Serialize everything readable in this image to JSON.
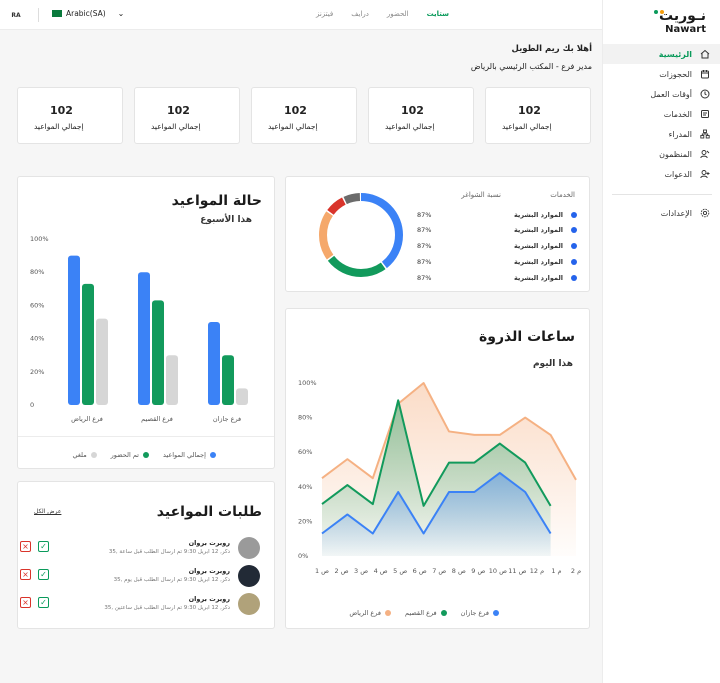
{
  "sidebar": {
    "logo": {
      "arabic": "نـوريت",
      "english": "Nawart"
    },
    "items": [
      {
        "label": "الرئيسية",
        "icon": "home-icon",
        "active": true
      },
      {
        "label": "الحجوزات",
        "icon": "bookings-icon"
      },
      {
        "label": "أوقات العمل",
        "icon": "clock-icon"
      },
      {
        "label": "الخدمات",
        "icon": "services-icon"
      },
      {
        "label": "المدراء",
        "icon": "managers-icon"
      },
      {
        "label": "المنظمون",
        "icon": "organizers-icon"
      },
      {
        "label": "الدعوات",
        "icon": "invitations-icon"
      }
    ],
    "settings": {
      "label": "الإعدادات",
      "icon": "settings-icon"
    }
  },
  "topbar": {
    "avatar": "RA",
    "language": "Arabic(SA)",
    "tabs": [
      {
        "label": "فيتزنز",
        "active": false
      },
      {
        "label": "درايف",
        "active": false
      },
      {
        "label": "الحضور",
        "active": false
      },
      {
        "label": "ستايت",
        "active": true
      }
    ]
  },
  "welcome": {
    "title": "أهلا بك ريم الطويل",
    "subtitle": "مدير فرع - المكتب الرئيسي بالرياض"
  },
  "stats": [
    {
      "value": "102",
      "label": "إجمالي المواعيد"
    },
    {
      "value": "102",
      "label": "إجمالي المواعيد"
    },
    {
      "value": "102",
      "label": "إجمالي المواعيد"
    },
    {
      "value": "102",
      "label": "إجمالي المواعيد"
    },
    {
      "value": "102",
      "label": "إجمالي المواعيد"
    }
  ],
  "services": {
    "header_services": "الخدمات",
    "header_vacancy": "نسبة الشواغر",
    "rows": [
      {
        "name": "الموارد البشرية",
        "pct": "87%"
      },
      {
        "name": "الموارد البشرية",
        "pct": "87%"
      },
      {
        "name": "الموارد البشرية",
        "pct": "87%"
      },
      {
        "name": "الموارد البشرية",
        "pct": "87%"
      },
      {
        "name": "الموارد البشرية",
        "pct": "87%"
      }
    ]
  },
  "appointments": {
    "title": "حالة المواعيد",
    "subtitle": "هذا الأسبوع",
    "legend": [
      "إجمالي المواعيد",
      "تم الحضور",
      "ملغي"
    ]
  },
  "peak": {
    "title": "ساعات الذروة",
    "subtitle": "هذا اليوم",
    "legend": [
      "فرع جازان",
      "فرع القصيم",
      "فرع الرياض"
    ]
  },
  "requests": {
    "title": "طلبات المواعيد",
    "show_all": "عرض الكل",
    "items": [
      {
        "name": "روبرت بروان",
        "detail": "35, دكر, 12 ابريل 9:30 تم ارسال الطلب قبل ساعة",
        "avatar": "#9a9a9a"
      },
      {
        "name": "روبرت بروان",
        "detail": "35, دكر, 12 ابريل 9:30 تم ارسال الطلب قبل يوم",
        "avatar": "#222a36"
      },
      {
        "name": "روبرت بروان",
        "detail": "35, دكر, 12 ابريل 9:30 تم ارسال الطلب قبل ساعتين",
        "avatar": "#b0a27a"
      }
    ]
  },
  "colors": {
    "accent": "#0a9a5b",
    "blue": "#3b82f6",
    "green": "#129a5c",
    "gray": "#d6d6d6",
    "orange": "#f5b183",
    "danger": "#d9342b"
  },
  "chart_data": [
    {
      "type": "donut",
      "values": [
        40,
        25,
        20,
        8,
        7
      ],
      "colors": [
        "#3b82f6",
        "#129a5c",
        "#f5a86b",
        "#d9342b",
        "#6b6b6b"
      ]
    },
    {
      "type": "bar",
      "categories": [
        "فرع الرياض",
        "فرع القصيم",
        "فرع جازان"
      ],
      "series": [
        {
          "name": "إجمالي المواعيد",
          "color": "#3b82f6",
          "values": [
            90,
            80,
            50
          ]
        },
        {
          "name": "تم الحضور",
          "color": "#129a5c",
          "values": [
            73,
            63,
            30
          ]
        },
        {
          "name": "ملغي",
          "color": "#d6d6d6",
          "values": [
            52,
            30,
            10
          ]
        }
      ],
      "yticks": [
        "0",
        "20%",
        "40%",
        "60%",
        "80%",
        "100%"
      ],
      "ylim": [
        0,
        100
      ]
    },
    {
      "type": "area",
      "categories": [
        "2 م",
        "1 م",
        "12 م",
        "11 ص",
        "10 ص",
        "9 ص",
        "8 ص",
        "7 ص",
        "6 ص",
        "5 ص",
        "4 ص",
        "3 ص",
        "2 ص",
        "1 ص"
      ],
      "series": [
        {
          "name": "فرع الرياض",
          "color": "#f5b183",
          "values": [
            45,
            56,
            45,
            88,
            100,
            72,
            70,
            70,
            80,
            70,
            44
          ]
        },
        {
          "name": "فرع القصيم",
          "color": "#129a5c",
          "values": [
            30,
            41,
            30,
            90,
            29,
            54,
            54,
            65,
            54,
            29
          ]
        },
        {
          "name": "فرع جازان",
          "color": "#3b82f6",
          "values": [
            13,
            24,
            13,
            37,
            13,
            37,
            37,
            48,
            37,
            13
          ]
        }
      ],
      "yticks": [
        "0%",
        "20%",
        "40%",
        "60%",
        "80%",
        "100%"
      ],
      "ylim": [
        0,
        100
      ]
    }
  ]
}
